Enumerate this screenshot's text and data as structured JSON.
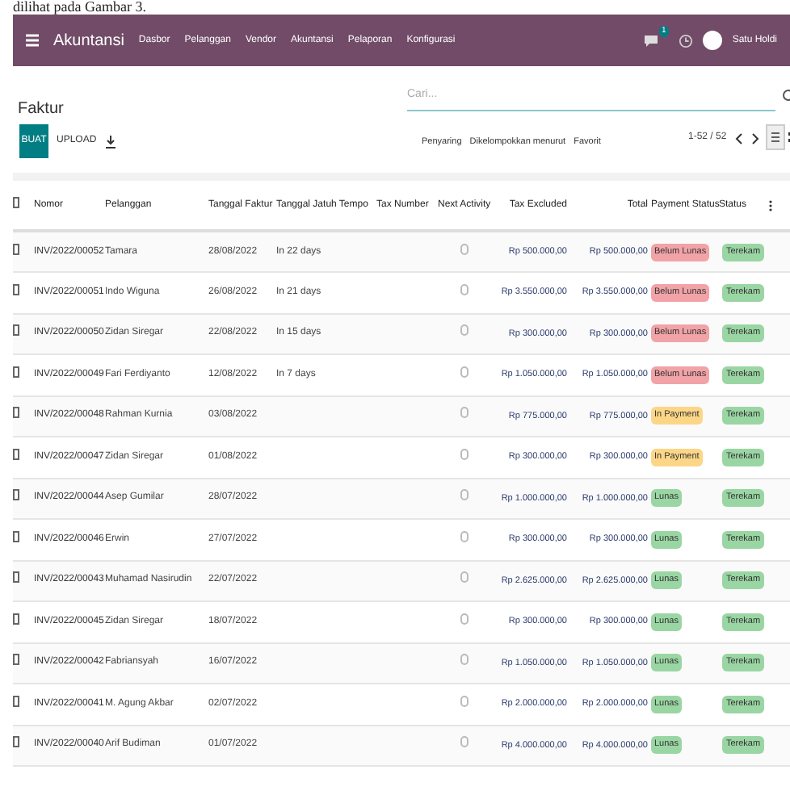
{
  "caption": "dilihat pada Gambar 3.",
  "navbar": {
    "app": "Akuntansi",
    "menu": [
      "Dasbor",
      "Pelanggan",
      "Vendor",
      "Akuntansi",
      "Pelaporan",
      "Konfigurasi"
    ],
    "message_count": "1",
    "user": "Satu Holdi"
  },
  "page_title": "Faktur",
  "search": {
    "placeholder": "Cari..."
  },
  "buttons": {
    "create": "BUAT",
    "upload": "UPLOAD"
  },
  "filters": [
    "Penyaring",
    "Dikelompokkan menurut",
    "Favorit"
  ],
  "pager": "1-52 / 52",
  "table": {
    "all_selected": false,
    "columns": [
      "Nomor",
      "Pelanggan",
      "Tanggal Faktur",
      "Tanggal Jatuh Tempo",
      "Tax Number",
      "Next Activity",
      "Tax Excluded",
      "Total",
      "Payment Status",
      "Status"
    ],
    "rows": [
      {
        "selected": false,
        "number": "INV/2022/00052",
        "customer": "Tamara",
        "invoice_date": "28/08/2022",
        "due": "In 22 days",
        "tax_excluded": "Rp 500.000,00",
        "total": "Rp 500.000,00",
        "payment_status": {
          "label": "Belum Lunas",
          "kind": "unpaid"
        },
        "status": "Terekam"
      },
      {
        "selected": false,
        "number": "INV/2022/00051",
        "customer": "Indo Wiguna",
        "invoice_date": "26/08/2022",
        "due": "In 21 days",
        "tax_excluded": "Rp 3.550.000,00",
        "total": "Rp 3.550.000,00",
        "payment_status": {
          "label": "Belum Lunas",
          "kind": "unpaid"
        },
        "status": "Terekam"
      },
      {
        "selected": false,
        "number": "INV/2022/00050",
        "customer": "Zidan Siregar",
        "invoice_date": "22/08/2022",
        "due": "In 15 days",
        "tax_excluded": "Rp 300.000,00",
        "total": "Rp 300.000,00",
        "payment_status": {
          "label": "Belum Lunas",
          "kind": "unpaid"
        },
        "status": "Terekam"
      },
      {
        "selected": false,
        "number": "INV/2022/00049",
        "customer": "Fari Ferdiyanto",
        "invoice_date": "12/08/2022",
        "due": "In 7 days",
        "tax_excluded": "Rp 1.050.000,00",
        "total": "Rp 1.050.000,00",
        "payment_status": {
          "label": "Belum Lunas",
          "kind": "unpaid"
        },
        "status": "Terekam"
      },
      {
        "selected": false,
        "number": "INV/2022/00048",
        "customer": "Rahman Kurnia",
        "invoice_date": "03/08/2022",
        "tax_excluded": "Rp 775.000,00",
        "total": "Rp 775.000,00",
        "payment_status": {
          "label": "In Payment",
          "kind": "in_payment"
        },
        "status": "Terekam"
      },
      {
        "selected": false,
        "number": "INV/2022/00047",
        "customer": "Zidan Siregar",
        "invoice_date": "01/08/2022",
        "tax_excluded": "Rp 300.000,00",
        "total": "Rp 300.000,00",
        "payment_status": {
          "label": "In Payment",
          "kind": "in_payment"
        },
        "status": "Terekam"
      },
      {
        "selected": false,
        "number": "INV/2022/00044",
        "customer": "Asep Gumilar",
        "invoice_date": "28/07/2022",
        "tax_excluded": "Rp 1.000.000,00",
        "total": "Rp 1.000.000,00",
        "payment_status": {
          "label": "Lunas",
          "kind": "paid"
        },
        "status": "Terekam"
      },
      {
        "selected": false,
        "number": "INV/2022/00046",
        "customer": "Erwin",
        "invoice_date": "27/07/2022",
        "tax_excluded": "Rp 300.000,00",
        "total": "Rp 300.000,00",
        "payment_status": {
          "label": "Lunas",
          "kind": "paid"
        },
        "status": "Terekam"
      },
      {
        "selected": false,
        "number": "INV/2022/00043",
        "customer": "Muhamad Nasirudin",
        "invoice_date": "22/07/2022",
        "tax_excluded": "Rp 2.625.000,00",
        "total": "Rp 2.625.000,00",
        "payment_status": {
          "label": "Lunas",
          "kind": "paid"
        },
        "status": "Terekam"
      },
      {
        "selected": false,
        "number": "INV/2022/00045",
        "customer": "Zidan Siregar",
        "invoice_date": "18/07/2022",
        "tax_excluded": "Rp 300.000,00",
        "total": "Rp 300.000,00",
        "payment_status": {
          "label": "Lunas",
          "kind": "paid"
        },
        "status": "Terekam"
      },
      {
        "selected": false,
        "number": "INV/2022/00042",
        "customer": "Fabriansyah",
        "invoice_date": "16/07/2022",
        "tax_excluded": "Rp 1.050.000,00",
        "total": "Rp 1.050.000,00",
        "payment_status": {
          "label": "Lunas",
          "kind": "paid"
        },
        "status": "Terekam"
      },
      {
        "selected": false,
        "number": "INV/2022/00041",
        "customer": "M. Agung Akbar",
        "invoice_date": "02/07/2022",
        "tax_excluded": "Rp 2.000.000,00",
        "total": "Rp 2.000.000,00",
        "payment_status": {
          "label": "Lunas",
          "kind": "paid"
        },
        "status": "Terekam"
      },
      {
        "selected": false,
        "number": "INV/2022/00040",
        "customer": "Arif Budiman",
        "invoice_date": "01/07/2022",
        "tax_excluded": "Rp 4.000.000,00",
        "total": "Rp 4.000.000,00",
        "payment_status": {
          "label": "Lunas",
          "kind": "paid"
        },
        "status": "Terekam"
      }
    ]
  }
}
